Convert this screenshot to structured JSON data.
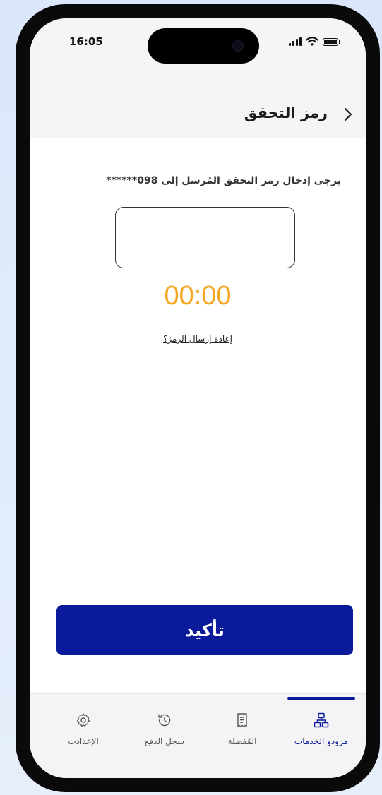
{
  "status_bar": {
    "time": "16:05"
  },
  "header": {
    "title": "رمز التحقق"
  },
  "instruction": "يرجى إدخال رمز التحقق المُرسل إلى 098******",
  "code_input": {
    "value": "",
    "placeholder": ""
  },
  "timer": "00:00",
  "resend_link": "إعادة إرسال الرمز؟",
  "confirm_button": "تأكيد",
  "tabs": [
    {
      "label": "مزودو الخدمات",
      "icon": "sitemap-icon",
      "active": true
    },
    {
      "label": "المُفضلة",
      "icon": "receipt-icon",
      "active": false
    },
    {
      "label": "سجل الدفع",
      "icon": "history-icon",
      "active": false
    },
    {
      "label": "الإعدادت",
      "icon": "gear-icon",
      "active": false
    }
  ],
  "colors": {
    "primary": "#0a1a9a",
    "timer": "#f5a623"
  }
}
